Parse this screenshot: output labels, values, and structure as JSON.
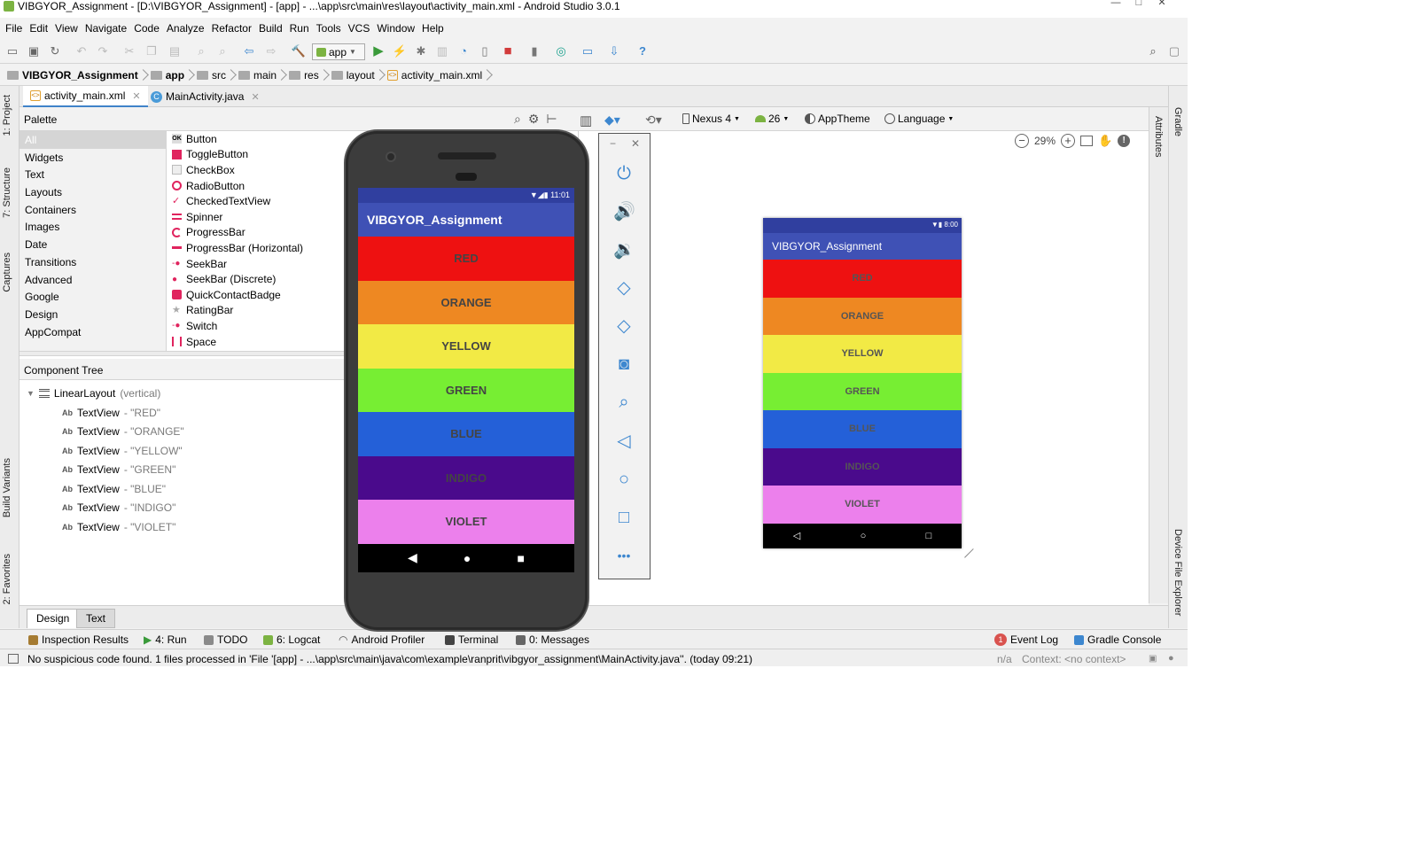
{
  "window": {
    "title": "VIBGYOR_Assignment - [D:\\VIBGYOR_Assignment] - [app] - ...\\app\\src\\main\\res\\layout\\activity_main.xml - Android Studio 3.0.1",
    "controls": [
      "—",
      "□",
      "✕"
    ]
  },
  "menu": [
    "File",
    "Edit",
    "View",
    "Navigate",
    "Code",
    "Analyze",
    "Refactor",
    "Build",
    "Run",
    "Tools",
    "VCS",
    "Window",
    "Help"
  ],
  "toolbar": {
    "run_config": "app",
    "icons": [
      "open-icon",
      "save-icon",
      "sync-icon",
      "undo-icon",
      "redo-icon",
      "cut-icon",
      "copy-icon",
      "paste-icon",
      "find-icon",
      "replace-icon",
      "back-icon",
      "forward-icon",
      "build-icon",
      "run-icon",
      "apply-changes-icon",
      "debug-icon",
      "profile-icon",
      "attach-icon",
      "stop-icon",
      "avd-manager-icon",
      "sync-gradle-icon",
      "project-structure-icon",
      "sdk-manager-icon",
      "help-icon",
      "search-icon"
    ]
  },
  "breadcrumb": [
    "VIBGYOR_Assignment",
    "app",
    "src",
    "main",
    "res",
    "layout",
    "activity_main.xml"
  ],
  "tabs": [
    {
      "label": "activity_main.xml",
      "active": true
    },
    {
      "label": "MainActivity.java",
      "active": false
    }
  ],
  "side_left": [
    "1: Project",
    "7: Structure",
    "Captures",
    "Build Variants",
    "2: Favorites"
  ],
  "side_right": [
    "Gradle",
    "Device File Explorer"
  ],
  "attributes_label": "Attributes",
  "palette": {
    "title": "Palette",
    "categories": [
      "All",
      "Widgets",
      "Text",
      "Layouts",
      "Containers",
      "Images",
      "Date",
      "Transitions",
      "Advanced",
      "Google",
      "Design",
      "AppCompat"
    ],
    "selected": "All",
    "widgets": [
      "Button",
      "ToggleButton",
      "CheckBox",
      "RadioButton",
      "CheckedTextView",
      "Spinner",
      "ProgressBar",
      "ProgressBar (Horizontal)",
      "SeekBar",
      "SeekBar (Discrete)",
      "QuickContactBadge",
      "RatingBar",
      "Switch",
      "Space"
    ]
  },
  "component_tree": {
    "title": "Component Tree",
    "root": {
      "label": "LinearLayout",
      "suffix": "(vertical)"
    },
    "children": [
      {
        "label": "TextView",
        "value": "- \"RED\""
      },
      {
        "label": "TextView",
        "value": "- \"ORANGE\""
      },
      {
        "label": "TextView",
        "value": "- \"YELLOW\""
      },
      {
        "label": "TextView",
        "value": "- \"GREEN\""
      },
      {
        "label": "TextView",
        "value": "- \"BLUE\""
      },
      {
        "label": "TextView",
        "value": "- \"INDIGO\""
      },
      {
        "label": "TextView",
        "value": "- \"VIOLET\""
      }
    ]
  },
  "design_toolbar": {
    "device": "Nexus 4",
    "api": "26",
    "theme": "AppTheme",
    "language": "Language",
    "zoom": "29%"
  },
  "bottom_tabs": [
    {
      "label": "Design",
      "active": true
    },
    {
      "label": "Text",
      "active": false
    }
  ],
  "emulator": {
    "time": "11:01",
    "app_title": "VIBGYOR_Assignment",
    "panel_icons": [
      "power-icon",
      "volume-up-icon",
      "volume-down-icon",
      "rotate-left-icon",
      "rotate-right-icon",
      "camera-icon",
      "zoom-icon",
      "back-icon",
      "home-icon",
      "overview-icon",
      "more-icon"
    ]
  },
  "preview": {
    "time": "8:00",
    "app_title": "VIBGYOR_Assignment"
  },
  "bands": [
    {
      "label": "RED",
      "color": "#ee1111"
    },
    {
      "label": "ORANGE",
      "color": "#ee8822"
    },
    {
      "label": "YELLOW",
      "color": "#f2ea45"
    },
    {
      "label": "GREEN",
      "color": "#77ee33"
    },
    {
      "label": "BLUE",
      "color": "#2460d8"
    },
    {
      "label": "INDIGO",
      "color": "#4a0a8c"
    },
    {
      "label": "VIOLET",
      "color": "#ec80ec"
    }
  ],
  "tool_windows_left": [
    {
      "label": "Inspection Results"
    },
    {
      "label": "4: Run"
    },
    {
      "label": "TODO"
    },
    {
      "label": "6: Logcat"
    },
    {
      "label": "Android Profiler"
    },
    {
      "label": "Terminal"
    },
    {
      "label": "0: Messages"
    }
  ],
  "tool_windows_right": [
    {
      "label": "Event Log",
      "badge": "1"
    },
    {
      "label": "Gradle Console"
    }
  ],
  "status": {
    "message": "No suspicious code found. 1 files processed in 'File '[app] - ...\\app\\src\\main\\java\\com\\example\\ranprit\\vibgyor_assignment\\MainActivity.java''. (today 09:21)",
    "position": "n/a",
    "context": "Context: <no context>"
  }
}
